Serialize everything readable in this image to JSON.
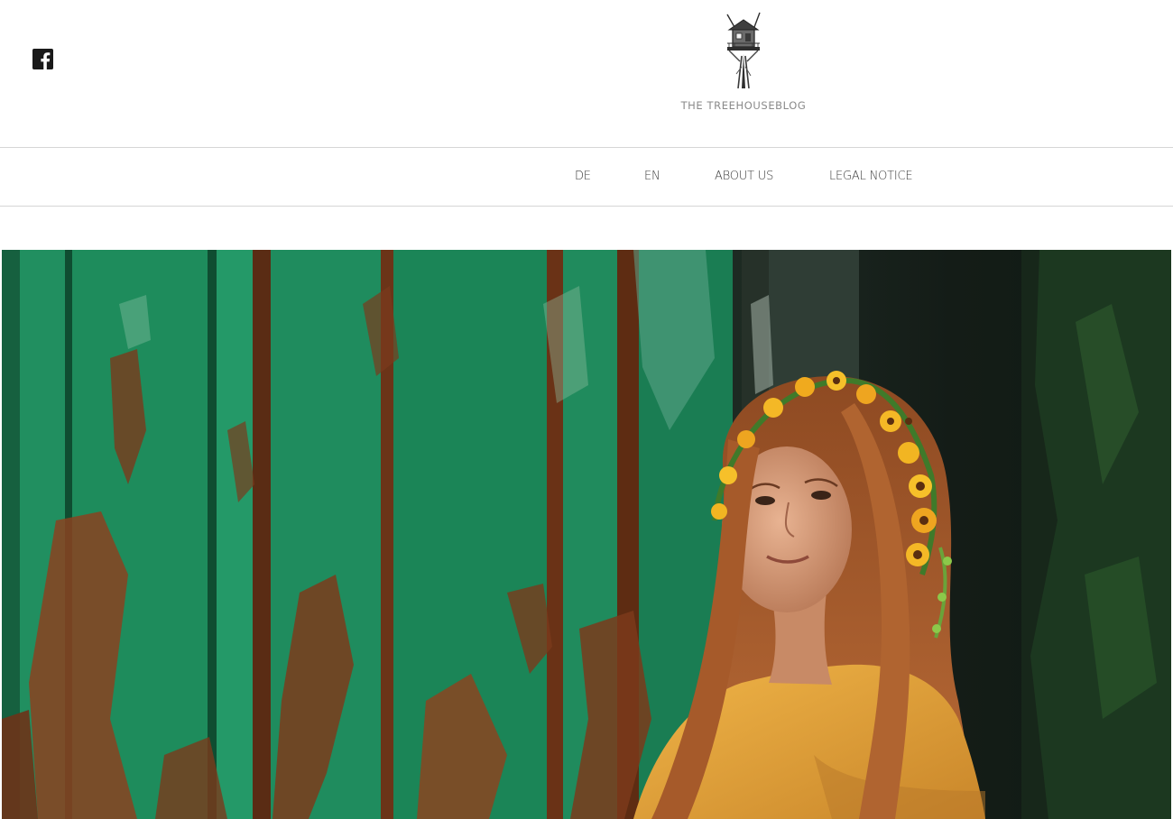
{
  "header": {
    "social": {
      "facebook_icon": "facebook-icon"
    },
    "logo": {
      "text": "THE TREEHOUSEBLOG",
      "icon": "treehouse-logo"
    }
  },
  "nav": {
    "items": [
      {
        "label": "DE"
      },
      {
        "label": "EN"
      },
      {
        "label": "ABOUT US"
      },
      {
        "label": "LEGAL NOTICE"
      }
    ]
  },
  "hero": {
    "description": "",
    "colors": {
      "door_green": "#1f8a5c",
      "rust": "#7a3a1c",
      "shirt": "#e2a43a",
      "hair": "#a8582a"
    }
  }
}
